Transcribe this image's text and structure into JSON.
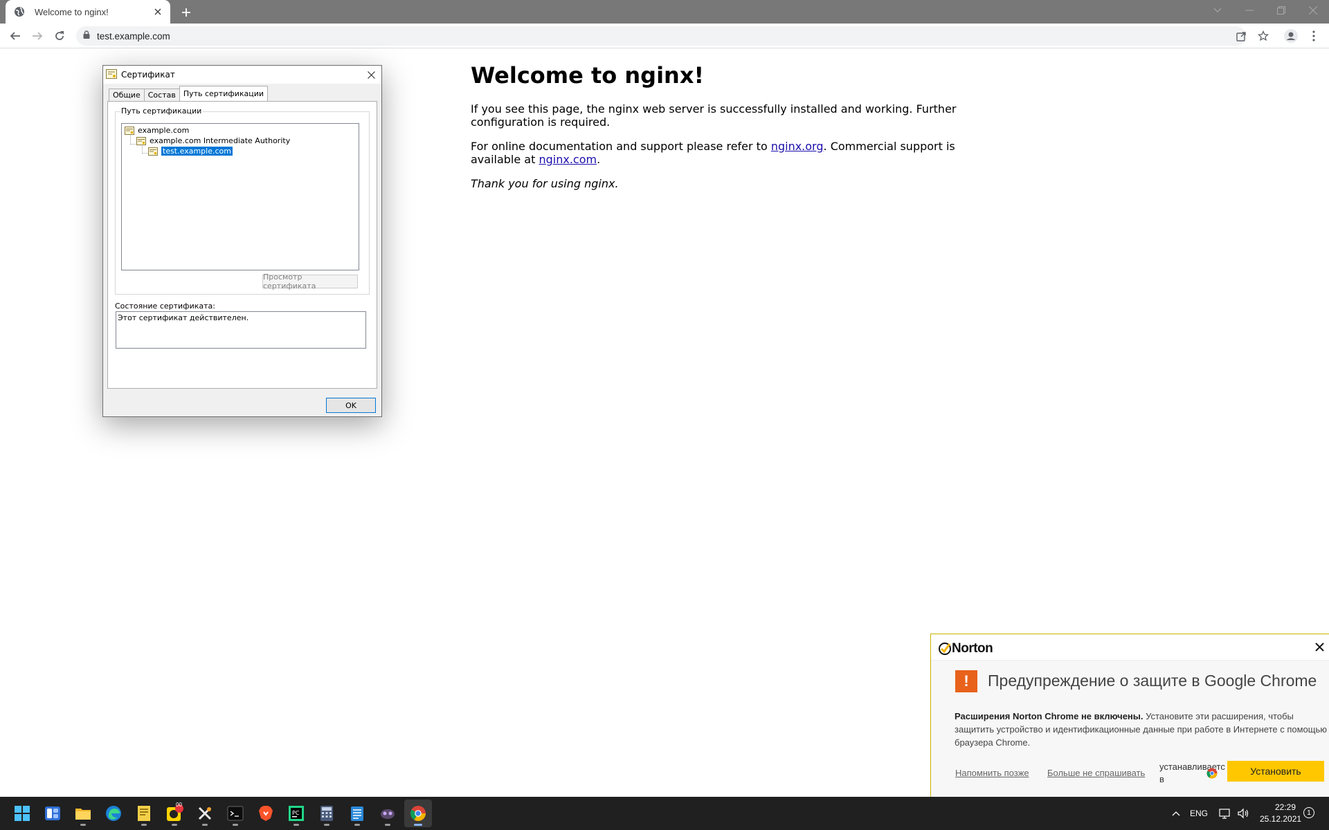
{
  "browser": {
    "tab_title": "Welcome to nginx!",
    "url": "test.example.com"
  },
  "page": {
    "heading": "Welcome to nginx!",
    "para1": "If you see this page, the nginx web server is successfully installed and working. Further configuration is required.",
    "para2_pre": "For online documentation and support please refer to ",
    "link1": "nginx.org",
    "para2_mid": ". Commercial support is available at ",
    "link2": "nginx.com",
    "para2_end": ".",
    "thanks": "Thank you for using nginx."
  },
  "cert_dialog": {
    "title": "Сертификат",
    "tabs": [
      "Общие",
      "Состав",
      "Путь сертификации"
    ],
    "active_tab": "Путь сертификации",
    "group_label": "Путь сертификации",
    "tree": [
      "example.com",
      "example.com Intermediate Authority",
      "test.example.com"
    ],
    "selected": "test.example.com",
    "view_button": "Просмотр сертификата",
    "status_label": "Состояние сертификата:",
    "status_text": "Этот сертификат действителен.",
    "ok_button": "OK"
  },
  "norton": {
    "brand": "Norton",
    "title": "Предупреждение о защите в Google Chrome",
    "text_bold": "Расширения Norton Chrome не включены.",
    "text_rest": " Установите эти расширения, чтобы защитить устройство и идентификационные данные при работе в Интернете с помощью браузера Chrome.",
    "remind_later": "Напомнить позже",
    "dont_ask": "Больше не спрашивать",
    "installing_line1": "устанавливаетс",
    "installing_line2": "в",
    "install_button": "Установить"
  },
  "taskbar": {
    "lang": "ENG",
    "time": "22:29",
    "date": "25.12.2021",
    "notifications": "1",
    "badge": "00"
  }
}
